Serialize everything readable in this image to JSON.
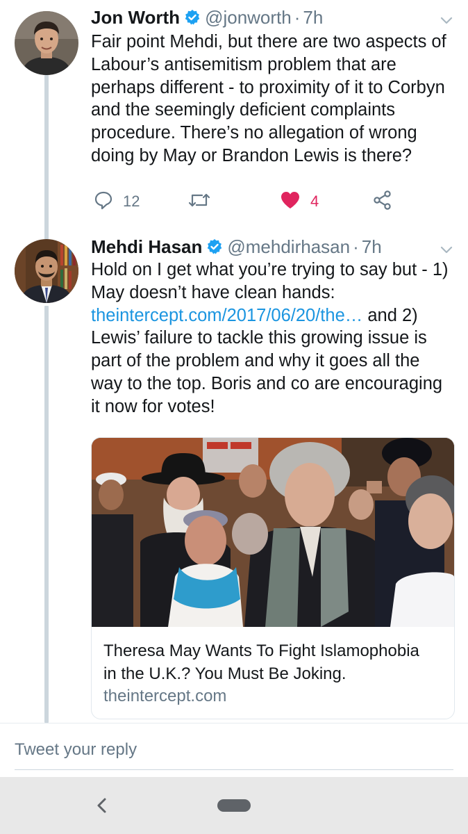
{
  "tweets": [
    {
      "name": "Jon Worth",
      "handle": "@jonworth",
      "separator": "·",
      "time": "7h",
      "text_lines": [
        "Fair point Mehdi, but there are two aspects of",
        "Labour’s antisemitism problem that are",
        "perhaps different - to proximity of it to Corbyn",
        "and the seemingly deficient complaints",
        "procedure. There’s no allegation of wrong",
        "doing by May or Brandon Lewis is there?"
      ],
      "reply_count": "12",
      "like_count": "4",
      "icons": [
        "verified-badge-icon",
        "chevron-down-icon",
        "reply-icon",
        "retweet-icon",
        "heart-icon",
        "share-icon"
      ]
    },
    {
      "name": "Mehdi Hasan",
      "handle": "@mehdirhasan",
      "separator": "·",
      "time": "7h",
      "text_line1": "Hold on I get what you’re trying to say but - 1)",
      "text_line2": "May doesn’t have clean hands:",
      "link_text": "theintercept.com/2017/06/20/the…",
      "text_after_link": " and 2)",
      "text_lines_rest": [
        "Lewis’ failure to tackle this growing issue is",
        "part of the problem and why it goes all the",
        "way to the top. Boris and co are encouraging",
        "it now for votes!"
      ],
      "card": {
        "title_line1": "Theresa May Wants To Fight Islamophobia",
        "title_line2": "in the U.K.? You Must Be Joking.",
        "domain": "theintercept.com"
      }
    }
  ],
  "reply": {
    "placeholder": "Tweet your reply"
  },
  "colors": {
    "link": "#1b95e0",
    "verified": "#1da1f2",
    "like": "#e0245e",
    "secondary_text": "#657786",
    "thread_line": "#ccd6dd"
  }
}
